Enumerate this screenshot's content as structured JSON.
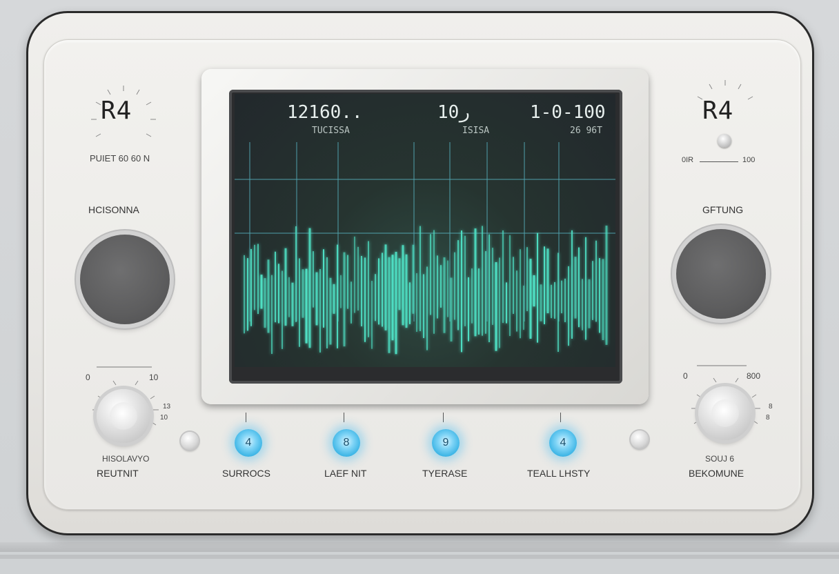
{
  "left_panel": {
    "display_code": "R4",
    "sub_label": "PUIET  60 60 N",
    "section_label": "HCISONNA",
    "scale_min": "0",
    "scale_max": "10",
    "scale_side_upper": "13",
    "scale_side_lower": "10",
    "knob_caption_top": "HISOLAVYO",
    "knob_caption": "REUTNIT"
  },
  "right_panel": {
    "display_code": "R4",
    "scale_left": "0IR",
    "scale_right": "100",
    "section_label": "GFTUNG",
    "scale_min": "0",
    "scale_max": "800",
    "scale_side_upper": "8",
    "scale_side_lower": "8",
    "knob_caption_top": "SOUJ 6",
    "knob_caption": "BEKOMUNE"
  },
  "screen": {
    "readout_left_main": "12160..",
    "readout_left_sub": "TUCISSA",
    "readout_mid_main": "10ر",
    "readout_mid_sub": "ISISA",
    "readout_right_main": "1-0-100",
    "readout_right_sub": "26 96T",
    "waveform_color": "#4fe0c4"
  },
  "buttons": [
    {
      "icon": "4",
      "label": "SURROCS"
    },
    {
      "icon": "8",
      "label": "LAEF NIT"
    },
    {
      "icon": "9",
      "label": "TYERASE"
    },
    {
      "icon": "4",
      "label": "TEALL LHSTY"
    }
  ]
}
